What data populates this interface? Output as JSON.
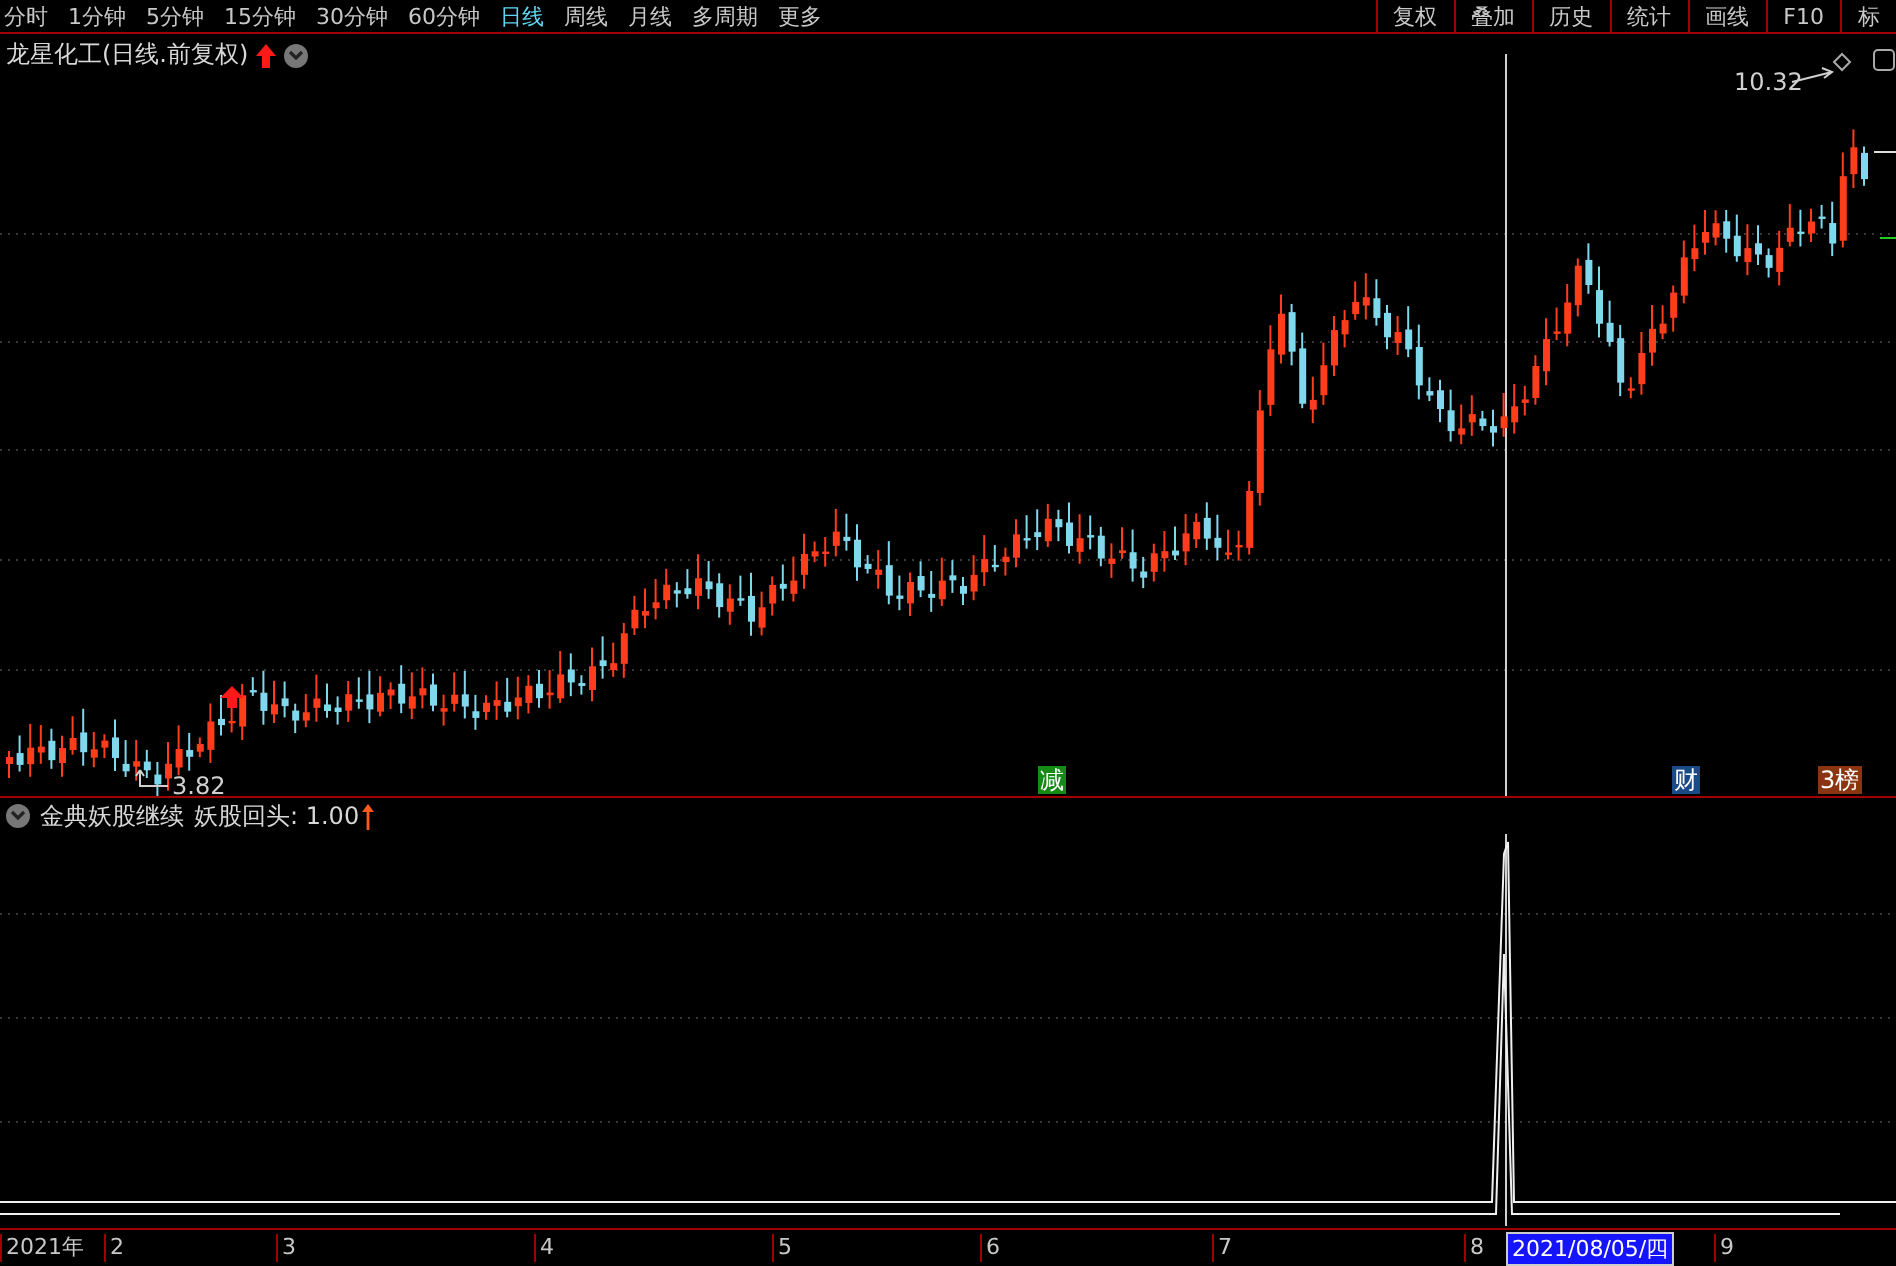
{
  "menu": {
    "periods": [
      {
        "label": "分时",
        "selected": false
      },
      {
        "label": "1分钟",
        "selected": false
      },
      {
        "label": "5分钟",
        "selected": false
      },
      {
        "label": "15分钟",
        "selected": false
      },
      {
        "label": "30分钟",
        "selected": false
      },
      {
        "label": "60分钟",
        "selected": false
      },
      {
        "label": "日线",
        "selected": true
      },
      {
        "label": "周线",
        "selected": false
      },
      {
        "label": "月线",
        "selected": false
      },
      {
        "label": "多周期",
        "selected": false
      },
      {
        "label": "更多",
        "selected": false
      }
    ],
    "tools": [
      "复权",
      "叠加",
      "历史",
      "统计",
      "画线",
      "F10",
      "标"
    ]
  },
  "main_chart": {
    "title": "龙星化工(日线.前复权)",
    "high_label": "10.32",
    "low_label": "3.82",
    "markers": [
      {
        "label": "减",
        "color": "#168a16"
      },
      {
        "label": "财",
        "color": "#1c4a86"
      },
      {
        "label": "3榜",
        "color": "#8a3410"
      }
    ]
  },
  "indicator": {
    "name": "金典妖股继续",
    "reading": "妖股回头: 1.00"
  },
  "x_axis": {
    "labels": [
      "2021年",
      "2",
      "3",
      "4",
      "5",
      "6",
      "7",
      "8",
      "9"
    ],
    "cursor_date": "2021/08/05/四"
  }
}
